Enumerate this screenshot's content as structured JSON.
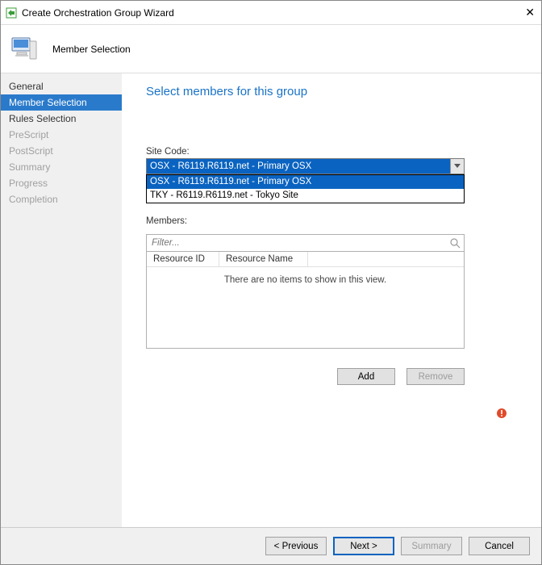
{
  "window": {
    "title": "Create Orchestration Group Wizard"
  },
  "header": {
    "title": "Member Selection"
  },
  "sidebar": {
    "items": [
      {
        "label": "General",
        "selected": false,
        "disabled": false
      },
      {
        "label": "Member Selection",
        "selected": true,
        "disabled": false
      },
      {
        "label": "Rules Selection",
        "selected": false,
        "disabled": false
      },
      {
        "label": "PreScript",
        "selected": false,
        "disabled": true
      },
      {
        "label": "PostScript",
        "selected": false,
        "disabled": true
      },
      {
        "label": "Summary",
        "selected": false,
        "disabled": true
      },
      {
        "label": "Progress",
        "selected": false,
        "disabled": true
      },
      {
        "label": "Completion",
        "selected": false,
        "disabled": true
      }
    ]
  },
  "main": {
    "heading": "Select members for this group",
    "siteCode": {
      "label": "Site Code:",
      "selected": "OSX - R6119.R6119.net - Primary OSX",
      "options": [
        "OSX - R6119.R6119.net - Primary OSX",
        "TKY - R6119.R6119.net - Tokyo Site"
      ]
    },
    "members": {
      "label": "Members:",
      "filterPlaceholder": "Filter...",
      "columns": [
        "Resource ID",
        "Resource Name"
      ],
      "emptyText": "There are no items to show in this view.",
      "addLabel": "Add",
      "removeLabel": "Remove"
    }
  },
  "footer": {
    "previous": "< Previous",
    "next": "Next >",
    "summary": "Summary",
    "cancel": "Cancel"
  }
}
